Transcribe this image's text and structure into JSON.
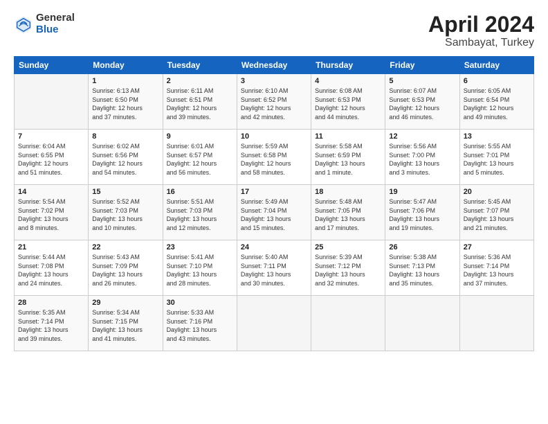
{
  "logo": {
    "general": "General",
    "blue": "Blue"
  },
  "title": {
    "month": "April 2024",
    "location": "Sambayat, Turkey"
  },
  "headers": [
    "Sunday",
    "Monday",
    "Tuesday",
    "Wednesday",
    "Thursday",
    "Friday",
    "Saturday"
  ],
  "weeks": [
    [
      {
        "day": "",
        "info": ""
      },
      {
        "day": "1",
        "info": "Sunrise: 6:13 AM\nSunset: 6:50 PM\nDaylight: 12 hours\nand 37 minutes."
      },
      {
        "day": "2",
        "info": "Sunrise: 6:11 AM\nSunset: 6:51 PM\nDaylight: 12 hours\nand 39 minutes."
      },
      {
        "day": "3",
        "info": "Sunrise: 6:10 AM\nSunset: 6:52 PM\nDaylight: 12 hours\nand 42 minutes."
      },
      {
        "day": "4",
        "info": "Sunrise: 6:08 AM\nSunset: 6:53 PM\nDaylight: 12 hours\nand 44 minutes."
      },
      {
        "day": "5",
        "info": "Sunrise: 6:07 AM\nSunset: 6:53 PM\nDaylight: 12 hours\nand 46 minutes."
      },
      {
        "day": "6",
        "info": "Sunrise: 6:05 AM\nSunset: 6:54 PM\nDaylight: 12 hours\nand 49 minutes."
      }
    ],
    [
      {
        "day": "7",
        "info": "Sunrise: 6:04 AM\nSunset: 6:55 PM\nDaylight: 12 hours\nand 51 minutes."
      },
      {
        "day": "8",
        "info": "Sunrise: 6:02 AM\nSunset: 6:56 PM\nDaylight: 12 hours\nand 54 minutes."
      },
      {
        "day": "9",
        "info": "Sunrise: 6:01 AM\nSunset: 6:57 PM\nDaylight: 12 hours\nand 56 minutes."
      },
      {
        "day": "10",
        "info": "Sunrise: 5:59 AM\nSunset: 6:58 PM\nDaylight: 12 hours\nand 58 minutes."
      },
      {
        "day": "11",
        "info": "Sunrise: 5:58 AM\nSunset: 6:59 PM\nDaylight: 13 hours\nand 1 minute."
      },
      {
        "day": "12",
        "info": "Sunrise: 5:56 AM\nSunset: 7:00 PM\nDaylight: 13 hours\nand 3 minutes."
      },
      {
        "day": "13",
        "info": "Sunrise: 5:55 AM\nSunset: 7:01 PM\nDaylight: 13 hours\nand 5 minutes."
      }
    ],
    [
      {
        "day": "14",
        "info": "Sunrise: 5:54 AM\nSunset: 7:02 PM\nDaylight: 13 hours\nand 8 minutes."
      },
      {
        "day": "15",
        "info": "Sunrise: 5:52 AM\nSunset: 7:03 PM\nDaylight: 13 hours\nand 10 minutes."
      },
      {
        "day": "16",
        "info": "Sunrise: 5:51 AM\nSunset: 7:03 PM\nDaylight: 13 hours\nand 12 minutes."
      },
      {
        "day": "17",
        "info": "Sunrise: 5:49 AM\nSunset: 7:04 PM\nDaylight: 13 hours\nand 15 minutes."
      },
      {
        "day": "18",
        "info": "Sunrise: 5:48 AM\nSunset: 7:05 PM\nDaylight: 13 hours\nand 17 minutes."
      },
      {
        "day": "19",
        "info": "Sunrise: 5:47 AM\nSunset: 7:06 PM\nDaylight: 13 hours\nand 19 minutes."
      },
      {
        "day": "20",
        "info": "Sunrise: 5:45 AM\nSunset: 7:07 PM\nDaylight: 13 hours\nand 21 minutes."
      }
    ],
    [
      {
        "day": "21",
        "info": "Sunrise: 5:44 AM\nSunset: 7:08 PM\nDaylight: 13 hours\nand 24 minutes."
      },
      {
        "day": "22",
        "info": "Sunrise: 5:43 AM\nSunset: 7:09 PM\nDaylight: 13 hours\nand 26 minutes."
      },
      {
        "day": "23",
        "info": "Sunrise: 5:41 AM\nSunset: 7:10 PM\nDaylight: 13 hours\nand 28 minutes."
      },
      {
        "day": "24",
        "info": "Sunrise: 5:40 AM\nSunset: 7:11 PM\nDaylight: 13 hours\nand 30 minutes."
      },
      {
        "day": "25",
        "info": "Sunrise: 5:39 AM\nSunset: 7:12 PM\nDaylight: 13 hours\nand 32 minutes."
      },
      {
        "day": "26",
        "info": "Sunrise: 5:38 AM\nSunset: 7:13 PM\nDaylight: 13 hours\nand 35 minutes."
      },
      {
        "day": "27",
        "info": "Sunrise: 5:36 AM\nSunset: 7:14 PM\nDaylight: 13 hours\nand 37 minutes."
      }
    ],
    [
      {
        "day": "28",
        "info": "Sunrise: 5:35 AM\nSunset: 7:14 PM\nDaylight: 13 hours\nand 39 minutes."
      },
      {
        "day": "29",
        "info": "Sunrise: 5:34 AM\nSunset: 7:15 PM\nDaylight: 13 hours\nand 41 minutes."
      },
      {
        "day": "30",
        "info": "Sunrise: 5:33 AM\nSunset: 7:16 PM\nDaylight: 13 hours\nand 43 minutes."
      },
      {
        "day": "",
        "info": ""
      },
      {
        "day": "",
        "info": ""
      },
      {
        "day": "",
        "info": ""
      },
      {
        "day": "",
        "info": ""
      }
    ]
  ]
}
